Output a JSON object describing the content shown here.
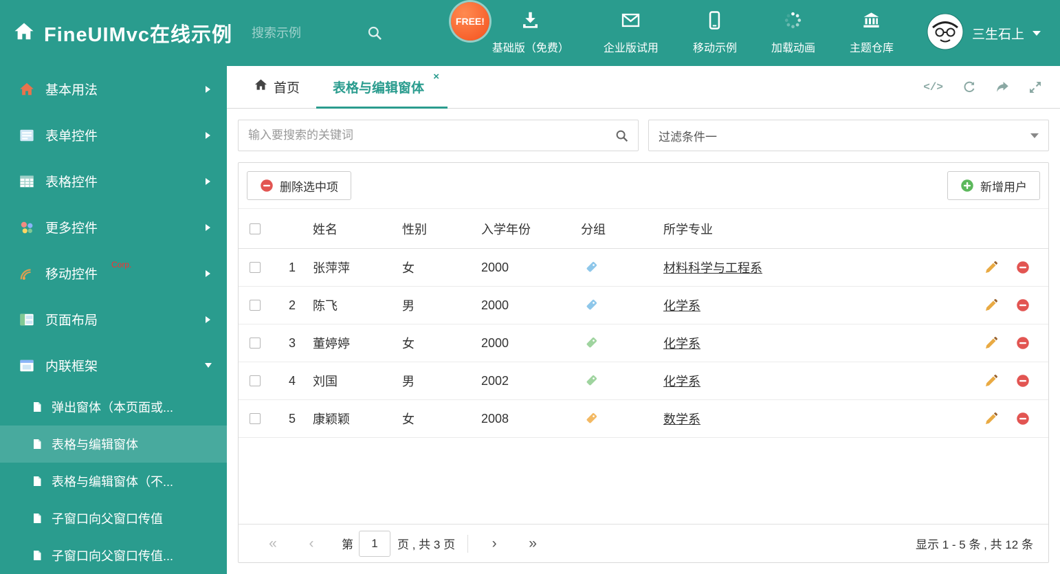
{
  "colors": {
    "accent": "#2a9c8e",
    "danger": "#e25552",
    "success": "#5cb85c"
  },
  "header": {
    "title": "FineUIMvc在线示例",
    "search_placeholder": "搜索示例",
    "free_badge": "FREE!",
    "nav": [
      {
        "label": "基础版（免费）",
        "icon": "download-icon"
      },
      {
        "label": "企业版试用",
        "icon": "envelope-icon"
      },
      {
        "label": "移动示例",
        "icon": "mobile-icon"
      },
      {
        "label": "加载动画",
        "icon": "spinner-icon"
      },
      {
        "label": "主题仓库",
        "icon": "bank-icon"
      }
    ],
    "user_name": "三生石上"
  },
  "sidebar": {
    "items": [
      {
        "label": "基本用法",
        "icon": "home-icon"
      },
      {
        "label": "表单控件",
        "icon": "form-icon"
      },
      {
        "label": "表格控件",
        "icon": "table-icon"
      },
      {
        "label": "更多控件",
        "icon": "widgets-icon"
      },
      {
        "label": "移动控件",
        "icon": "signal-icon",
        "badge": "Corp."
      },
      {
        "label": "页面布局",
        "icon": "layout-icon"
      },
      {
        "label": "内联框架",
        "icon": "frame-icon",
        "expanded": true
      }
    ],
    "subitems": [
      {
        "label": "弹出窗体（本页面或..."
      },
      {
        "label": "表格与编辑窗体",
        "active": true
      },
      {
        "label": "表格与编辑窗体（不..."
      },
      {
        "label": "子窗口向父窗口传值"
      },
      {
        "label": "子窗口向父窗口传值..."
      }
    ]
  },
  "tabs": {
    "home": "首页",
    "active": "表格与编辑窗体",
    "close_glyph": "×",
    "code_glyph": "</>"
  },
  "filters": {
    "search_placeholder": "输入要搜索的关键词",
    "filter_selected": "过滤条件一"
  },
  "toolbar": {
    "delete_label": "删除选中项",
    "add_label": "新增用户"
  },
  "table": {
    "headers": {
      "name": "姓名",
      "gender": "性别",
      "year": "入学年份",
      "group": "分组",
      "major": "所学专业"
    },
    "rows": [
      {
        "index": "1",
        "name": "张萍萍",
        "gender": "女",
        "year": "2000",
        "tag_color": "#8ec7ea",
        "major": "材料科学与工程系"
      },
      {
        "index": "2",
        "name": "陈飞",
        "gender": "男",
        "year": "2000",
        "tag_color": "#8ec7ea",
        "major": "化学系"
      },
      {
        "index": "3",
        "name": "董婷婷",
        "gender": "女",
        "year": "2000",
        "tag_color": "#9fd49f",
        "major": "化学系"
      },
      {
        "index": "4",
        "name": "刘国",
        "gender": "男",
        "year": "2002",
        "tag_color": "#9fd49f",
        "major": "化学系"
      },
      {
        "index": "5",
        "name": "康颖颖",
        "gender": "女",
        "year": "2008",
        "tag_color": "#f3b963",
        "major": "数学系"
      }
    ]
  },
  "pager": {
    "first": "«",
    "prev": "‹",
    "next": "›",
    "last": "»",
    "page_label_before": "第",
    "page_value": "1",
    "page_label_after": "页 , 共 3 页",
    "summary": "显示 1 - 5 条 , 共 12 条"
  }
}
